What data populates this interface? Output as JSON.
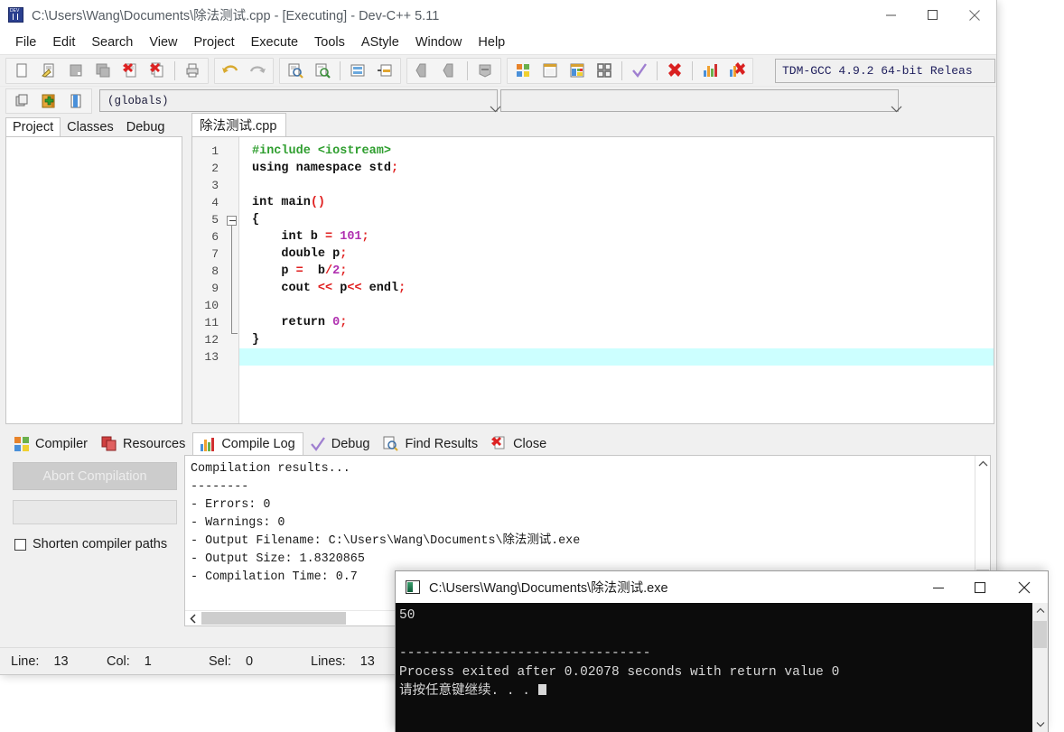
{
  "window": {
    "title": "C:\\Users\\Wang\\Documents\\除法测试.cpp - [Executing] - Dev-C++ 5.11",
    "minimize_label": "—",
    "maximize_label": "□",
    "close_label": "✕"
  },
  "menu": {
    "items": [
      "File",
      "Edit",
      "Search",
      "View",
      "Project",
      "Execute",
      "Tools",
      "AStyle",
      "Window",
      "Help"
    ]
  },
  "toolbar": {
    "compiler_combo_value": "TDM-GCC 4.9.2 64-bit Releas",
    "icons": [
      "new-file-icon",
      "open-file-icon",
      "save-file-icon",
      "save-all-icon",
      "close-file-icon",
      "close-all-icon",
      "print-icon",
      "undo-icon",
      "redo-icon",
      "find-icon",
      "find-replace-icon",
      "goto-line-icon",
      "goto-function-icon",
      "back-icon",
      "forward-icon",
      "toggle-bookmark-icon",
      "compile-icon",
      "run-icon",
      "compile-run-icon",
      "rebuild-all-icon",
      "syntax-check-icon",
      "stop-execution-icon",
      "profile-icon",
      "delete-profile-icon"
    ]
  },
  "toolbar2": {
    "icons": [
      "new-project-icon",
      "add-to-project-icon",
      "project-options-icon"
    ],
    "globals_combo_value": "(globals)",
    "member_combo_value": ""
  },
  "left_panel": {
    "tabs": [
      {
        "label": "Project",
        "active": true
      },
      {
        "label": "Classes",
        "active": false
      },
      {
        "label": "Debug",
        "active": false
      }
    ]
  },
  "editor": {
    "tab_label": "除法测试.cpp",
    "line_numbers": [
      "1",
      "2",
      "3",
      "4",
      "5",
      "6",
      "7",
      "8",
      "9",
      "10",
      "11",
      "12",
      "13"
    ],
    "lines": [
      {
        "n": 1,
        "tokens": [
          {
            "t": "#include ",
            "c": "pre"
          },
          {
            "t": "<iostream>",
            "c": "str"
          }
        ]
      },
      {
        "n": 2,
        "tokens": [
          {
            "t": "using namespace std",
            "c": "kw"
          },
          {
            "t": ";",
            "c": "sym"
          }
        ]
      },
      {
        "n": 3,
        "tokens": []
      },
      {
        "n": 4,
        "tokens": [
          {
            "t": "int main",
            "c": "kw"
          },
          {
            "t": "()",
            "c": "sym"
          }
        ]
      },
      {
        "n": 5,
        "tokens": [
          {
            "t": "{",
            "c": "kw"
          }
        ]
      },
      {
        "n": 6,
        "tokens": [
          {
            "t": "    int b ",
            "c": "kw"
          },
          {
            "t": "= ",
            "c": "sym"
          },
          {
            "t": "101",
            "c": "num"
          },
          {
            "t": ";",
            "c": "sym"
          }
        ]
      },
      {
        "n": 7,
        "tokens": [
          {
            "t": "    double p",
            "c": "kw"
          },
          {
            "t": ";",
            "c": "sym"
          }
        ]
      },
      {
        "n": 8,
        "tokens": [
          {
            "t": "    p ",
            "c": "kw"
          },
          {
            "t": "= ",
            "c": "sym"
          },
          {
            "t": " b",
            "c": "kw"
          },
          {
            "t": "/",
            "c": "sym"
          },
          {
            "t": "2",
            "c": "num"
          },
          {
            "t": ";",
            "c": "sym"
          }
        ]
      },
      {
        "n": 9,
        "tokens": [
          {
            "t": "    cout ",
            "c": "kw"
          },
          {
            "t": "<< ",
            "c": "sym"
          },
          {
            "t": "p",
            "c": "kw"
          },
          {
            "t": "<< ",
            "c": "sym"
          },
          {
            "t": "endl",
            "c": "kw"
          },
          {
            "t": ";",
            "c": "sym"
          }
        ]
      },
      {
        "n": 10,
        "tokens": []
      },
      {
        "n": 11,
        "tokens": [
          {
            "t": "    return ",
            "c": "kw"
          },
          {
            "t": "0",
            "c": "num"
          },
          {
            "t": ";",
            "c": "sym"
          }
        ]
      },
      {
        "n": 12,
        "tokens": [
          {
            "t": "}",
            "c": "kw"
          }
        ]
      },
      {
        "n": 13,
        "tokens": [],
        "highlight": true
      }
    ]
  },
  "bottom_panel": {
    "tabs": [
      {
        "label": "Compiler",
        "icon": "compiler-icon",
        "active": false
      },
      {
        "label": "Resources",
        "icon": "resources-icon",
        "active": false
      },
      {
        "label": "Compile Log",
        "icon": "compile-log-icon",
        "active": true
      },
      {
        "label": "Debug",
        "icon": "debug-check-icon",
        "active": false
      },
      {
        "label": "Find Results",
        "icon": "find-results-icon",
        "active": false
      },
      {
        "label": "Close",
        "icon": "close-red-icon",
        "active": false
      }
    ],
    "abort_button_label": "Abort Compilation",
    "shorten_checkbox_label": "Shorten compiler paths",
    "shorten_checked": false,
    "log_lines": [
      "Compilation results...",
      "--------",
      "- Errors: 0",
      "- Warnings: 0",
      "- Output Filename: C:\\Users\\Wang\\Documents\\除法测试.exe",
      "- Output Size: 1.8320865",
      "- Compilation Time: 0.7"
    ]
  },
  "statusbar": {
    "fields": [
      {
        "label": "Line:",
        "value": "13"
      },
      {
        "label": "Col:",
        "value": "1"
      },
      {
        "label": "Sel:",
        "value": "0"
      },
      {
        "label": "Lines:",
        "value": "13"
      }
    ]
  },
  "console": {
    "title": "C:\\Users\\Wang\\Documents\\除法测试.exe",
    "minimize_label": "—",
    "maximize_label": "□",
    "close_label": "✕",
    "output_lines": [
      "50",
      "",
      "--------------------------------",
      "Process exited after 0.02078 seconds with return value 0",
      "请按任意键继续. . ."
    ]
  },
  "colors": {
    "window_bg": "#f0f0f0",
    "editor_bg": "#ffffff",
    "highlight_line": "#ccffff",
    "console_bg": "#0c0c0c",
    "console_fg": "#d8d8d8",
    "code_keyword": "#111111",
    "code_number": "#b030b0",
    "code_symbol": "#e02020",
    "code_preprocessor": "#2e9e2e"
  }
}
